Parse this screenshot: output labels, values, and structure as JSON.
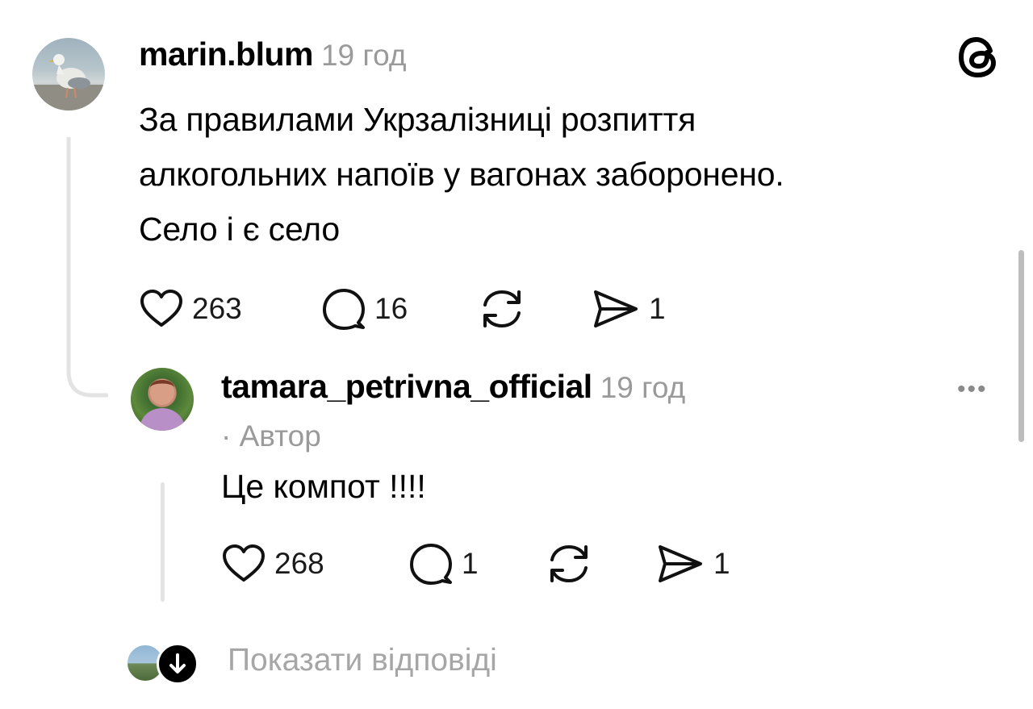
{
  "post": {
    "username": "marin.blum",
    "time": "19 год",
    "lines": [
      "За правилами Укрзалізниці розпиття",
      "алкогольних напоїв у вагонах заборонено.",
      "Село і є село"
    ],
    "likes": "263",
    "replies": "16",
    "shares": "1"
  },
  "reply": {
    "username": "tamara_petrivna_official",
    "time": "19 год",
    "author_tag": "· Автор",
    "text": "Це компот !!!!",
    "likes": "268",
    "replies": "1",
    "shares": "1"
  },
  "more_label": "•••",
  "show_replies": "Показати відповіді",
  "icons": {
    "app": "threads-logo-icon",
    "like": "heart-icon",
    "comment": "comment-icon",
    "repost": "repost-icon",
    "share": "share-icon",
    "expand": "arrow-down-icon"
  }
}
